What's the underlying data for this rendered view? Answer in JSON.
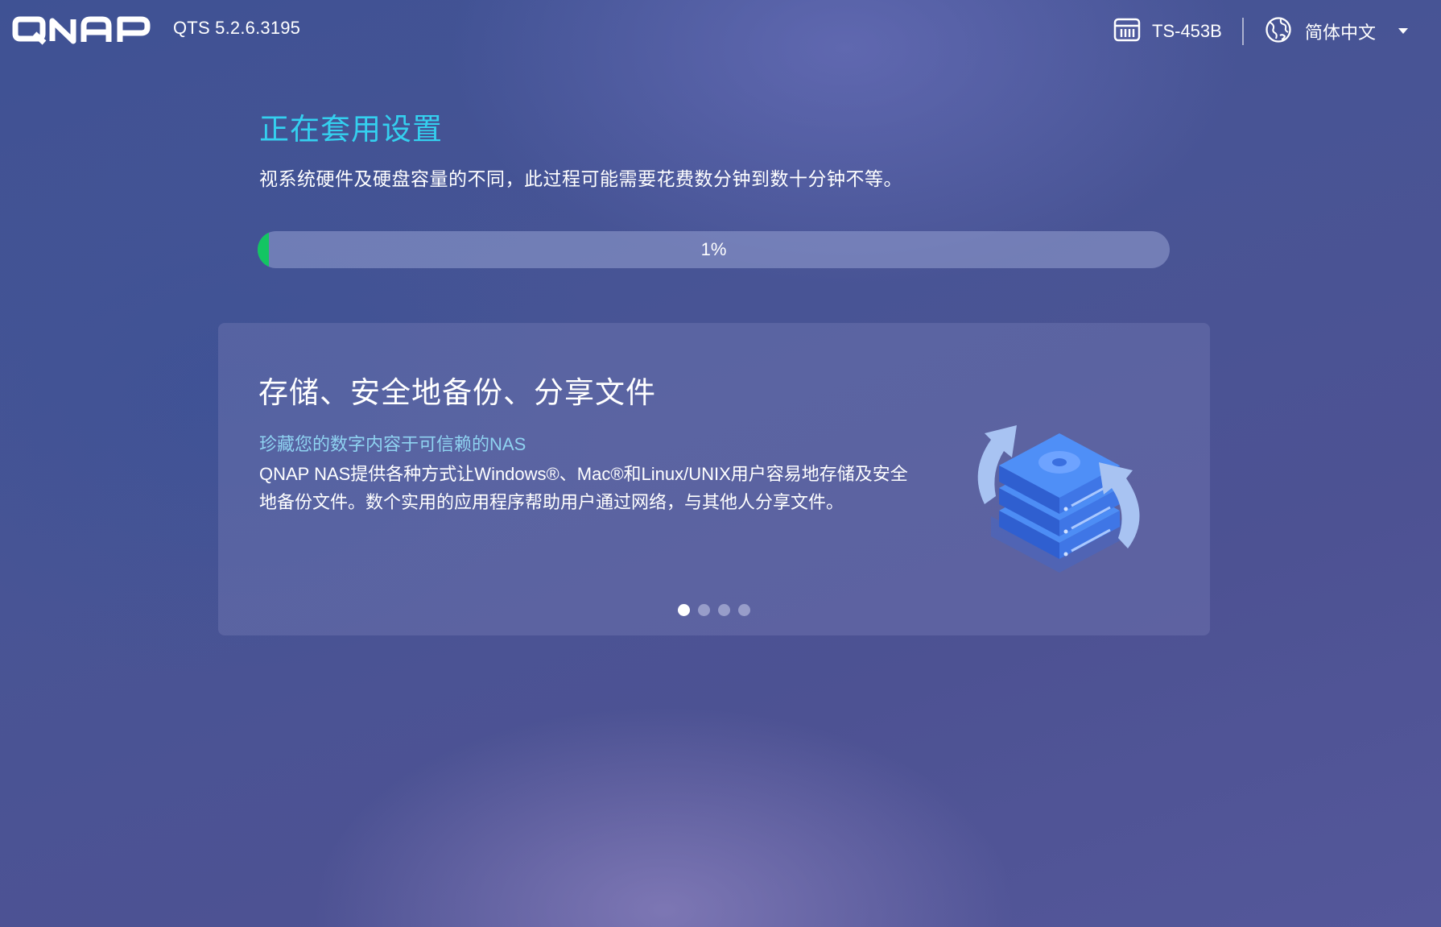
{
  "header": {
    "brand": "QNAP",
    "version": "QTS 5.2.6.3195",
    "device_icon": "nas-device-icon",
    "device_name": "TS-453B",
    "language_icon": "globe-icon",
    "language": "简体中文",
    "language_dropdown_icon": "caret-down-icon"
  },
  "status": {
    "title": "正在套用设置",
    "subtitle": "视系统硬件及硬盘容量的不同，此过程可能需要花费数分钟到数十分钟不等。",
    "progress_percent": 1,
    "progress_text": "1%",
    "progress_color": "#13c562"
  },
  "carousel": {
    "title": "存储、安全地备份、分享文件",
    "subtitle": "珍藏您的数字内容于可信赖的NAS",
    "body": "QNAP NAS提供各种方式让Windows®、Mac®和Linux/UNIX用户容易地存储及安全地备份文件。数个实用的应用程序帮助用户通过网络，与其他人分享文件。",
    "illustration_icon": "storage-backup-illustration",
    "pages": 4,
    "active_page": 0
  },
  "colors": {
    "title_accent": "#34d0ef",
    "subtitle_accent": "#8fd3f1",
    "progress": "#13c562"
  }
}
